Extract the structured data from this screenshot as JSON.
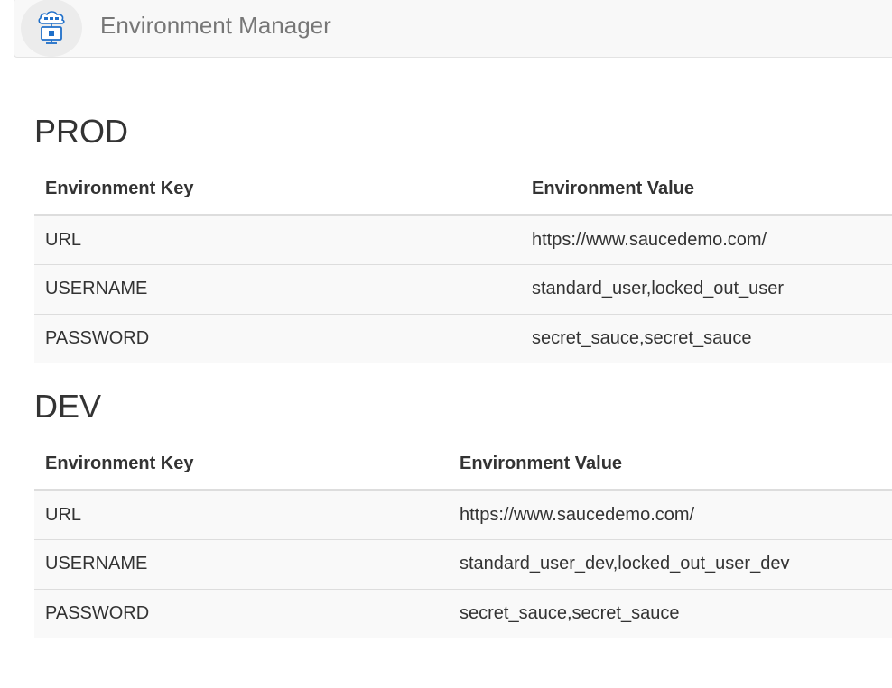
{
  "navbar": {
    "logo_icon": "cloud-monitor-icon",
    "title": "Environment Manager"
  },
  "environments": [
    {
      "name": "PROD",
      "columns": [
        "Environment Key",
        "Environment Value"
      ],
      "rows": [
        {
          "key": "URL",
          "value": "https://www.saucedemo.com/"
        },
        {
          "key": "USERNAME",
          "value": "standard_user,locked_out_user"
        },
        {
          "key": "PASSWORD",
          "value": "secret_sauce,secret_sauce"
        }
      ]
    },
    {
      "name": "DEV",
      "columns": [
        "Environment Key",
        "Environment Value"
      ],
      "rows": [
        {
          "key": "URL",
          "value": "https://www.saucedemo.com/"
        },
        {
          "key": "USERNAME",
          "value": "standard_user_dev,locked_out_user_dev"
        },
        {
          "key": "PASSWORD",
          "value": "secret_sauce,secret_sauce"
        }
      ]
    }
  ],
  "colors": {
    "navbar_bg": "#f8f8f8",
    "title_text": "#777777",
    "row_bg": "#f9f9f9",
    "icon_blue": "#1f6fc9"
  }
}
